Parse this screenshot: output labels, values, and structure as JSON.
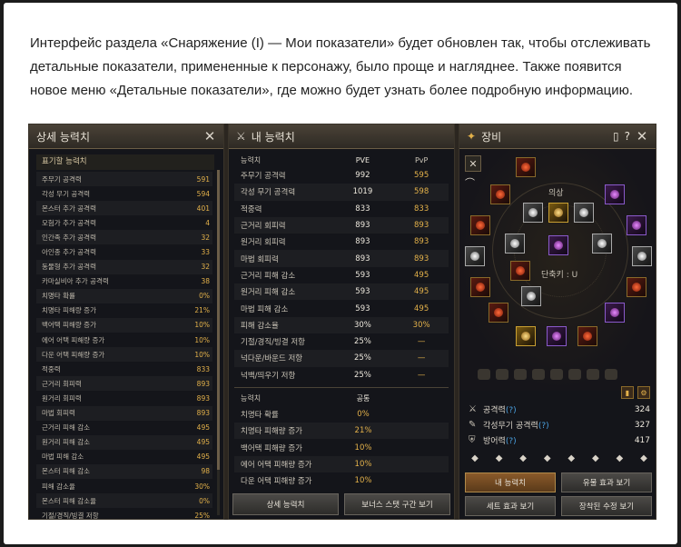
{
  "intro_text": "Интерфейс раздела «Снаряжение (I) — Мои показатели» будет обновлен так, чтобы отслеживать детальные показатели, примененные к персонажу, было проще и нагляднее. Также появится новое меню «Детальные показатели», где можно будет узнать более подробную информацию.",
  "detail_panel": {
    "title": "상세 능력치",
    "section_label": "표기할 능력치",
    "rows": [
      {
        "name": "주무기 공격력",
        "value": "591"
      },
      {
        "name": "각성 무기 공격력",
        "value": "594"
      },
      {
        "name": "몬스터 추가 공격력",
        "value": "401"
      },
      {
        "name": "모험가 추가 공격력",
        "value": "4"
      },
      {
        "name": "인간족 추가 공격력",
        "value": "32"
      },
      {
        "name": "아인종 추가 공격력",
        "value": "33"
      },
      {
        "name": "동물형 추가 공격력",
        "value": "32"
      },
      {
        "name": "카마실비아 추가 공격력",
        "value": "38"
      },
      {
        "name": "치명타 확률",
        "value": "0%"
      },
      {
        "name": "치명타 피해량 증가",
        "value": "21%"
      },
      {
        "name": "백어택 피해량 증가",
        "value": "10%"
      },
      {
        "name": "에어 어택 피해량 증가",
        "value": "10%"
      },
      {
        "name": "다운 어택 피해량 증가",
        "value": "10%"
      },
      {
        "name": "적중력",
        "value": "833"
      },
      {
        "name": "근거리 회피력",
        "value": "893"
      },
      {
        "name": "원거리 회피력",
        "value": "893"
      },
      {
        "name": "마법 회피력",
        "value": "893"
      },
      {
        "name": "근거리 피해 감소",
        "value": "495"
      },
      {
        "name": "원거리 피해 감소",
        "value": "495"
      },
      {
        "name": "마법 피해 감소",
        "value": "495"
      },
      {
        "name": "몬스터 피해 감소",
        "value": "98"
      },
      {
        "name": "피해 감소율",
        "value": "30%"
      },
      {
        "name": "몬스터 피해 감소율",
        "value": "0%"
      },
      {
        "name": "기절/경직/빙결 저항",
        "value": "25%"
      }
    ]
  },
  "my_stats_panel": {
    "title": "내 능력치",
    "header": {
      "name": "능력치",
      "pve": "PVE",
      "pvp": "PvP"
    },
    "rows": [
      {
        "name": "주무기 공격력",
        "pve": "992",
        "pvp": "595"
      },
      {
        "name": "각성 무기 공격력",
        "pve": "1019",
        "pvp": "598"
      },
      {
        "name": "적중력",
        "pve": "833",
        "pvp": "833"
      },
      {
        "name": "근거리 회피력",
        "pve": "893",
        "pvp": "893"
      },
      {
        "name": "원거리 회피력",
        "pve": "893",
        "pvp": "893"
      },
      {
        "name": "마법 회피력",
        "pve": "893",
        "pvp": "893"
      },
      {
        "name": "근거리 피해 감소",
        "pve": "593",
        "pvp": "495"
      },
      {
        "name": "원거리 피해 감소",
        "pve": "593",
        "pvp": "495"
      },
      {
        "name": "마법 피해 감소",
        "pve": "593",
        "pvp": "495"
      },
      {
        "name": "피해 감소율",
        "pve": "30%",
        "pvp": "30%"
      },
      {
        "name": "기절/경직/빙결 저항",
        "pve": "25%",
        "pvp": "—"
      },
      {
        "name": "넉다운/바운드 저항",
        "pve": "25%",
        "pvp": "—"
      },
      {
        "name": "넉백/띄우기 저항",
        "pve": "25%",
        "pvp": "—"
      }
    ],
    "header2": {
      "name": "능력치",
      "common": "공통"
    },
    "rows2": [
      {
        "name": "치명타 확률",
        "value": "0%"
      },
      {
        "name": "치명타 피해량 증가",
        "value": "21%"
      },
      {
        "name": "백어택 피해량 증가",
        "value": "10%"
      },
      {
        "name": "에어 어택 피해량 증가",
        "value": "10%"
      },
      {
        "name": "다운 어택 피해량 증가",
        "value": "10%"
      }
    ],
    "btn_detail": "상세 능력치",
    "btn_boss": "보너스 스탯 구간 보기"
  },
  "equip_panel": {
    "title": "장비",
    "costume_label": "의상",
    "shortcut_label": "단축키 : U",
    "stats": [
      {
        "name": "공격력",
        "help": "(?)",
        "value": "324"
      },
      {
        "name": "각성무기 공격력",
        "help": "(?)",
        "value": "327"
      },
      {
        "name": "방어력",
        "help": "(?)",
        "value": "417"
      }
    ],
    "btn_my_stats": "내 능력치",
    "btn_artifact": "유물 효과 보기",
    "btn_set": "세트 효과 보기",
    "btn_tuning": "장착된 수정 보기"
  }
}
